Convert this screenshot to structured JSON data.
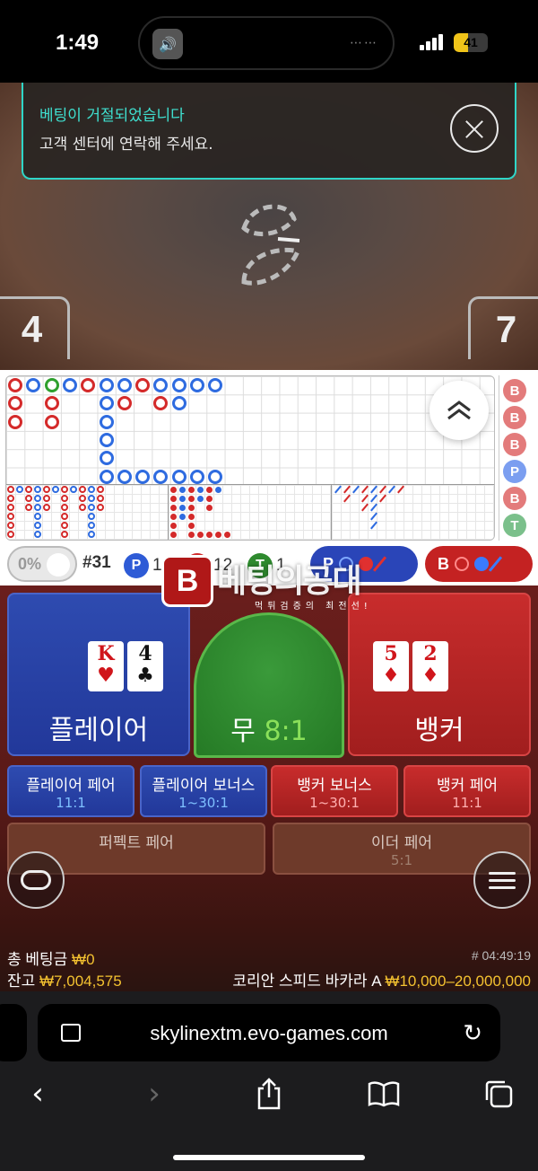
{
  "status_bar": {
    "time": "1:49",
    "battery": "41",
    "battery_level_percent": 41
  },
  "notification": {
    "title": "베팅이 거절되었습니다",
    "message": "고객 센터에 연락해 주세요."
  },
  "video": {
    "player_score": "4",
    "banker_score": "7"
  },
  "colors": {
    "player": "#2e4bb0",
    "banker": "#c82c2c",
    "tie": "#2e8a2e",
    "accent": "#2fd6c8",
    "gold": "#f4c230"
  },
  "side_column": [
    "B",
    "B",
    "B",
    "P",
    "B",
    "T"
  ],
  "stats": {
    "percent": "0%",
    "round": "#31",
    "player": {
      "badge": "P",
      "count": "18"
    },
    "banker": {
      "badge": "B",
      "count": "12"
    },
    "tie": {
      "badge": "T",
      "count": "1"
    },
    "player_ask": "P",
    "banker_ask": "B"
  },
  "watermark": {
    "icon": "B",
    "title": "베팅의공대",
    "subtitle": "먹튀검증의 최전선!"
  },
  "bets": {
    "player": {
      "label": "플레이어",
      "cards": [
        {
          "rank": "K",
          "suit": "♥"
        },
        {
          "rank": "4",
          "suit": "♣"
        }
      ]
    },
    "tie": {
      "label": "무",
      "odds": "8:1"
    },
    "banker": {
      "label": "뱅커",
      "cards": [
        {
          "rank": "5",
          "suit": "♦"
        },
        {
          "rank": "2",
          "suit": "♦"
        }
      ]
    },
    "side": [
      {
        "name": "플레이어 페어",
        "odds": "11:1"
      },
      {
        "name": "플레이어 보너스",
        "odds": "1~30:1"
      },
      {
        "name": "뱅커 보너스",
        "odds": "1~30:1"
      },
      {
        "name": "뱅커 페어",
        "odds": "11:1"
      }
    ],
    "perfect_pair": {
      "name": "퍼펙트 페어"
    },
    "either_pair": {
      "name": "이더 페어",
      "odds": "5:1"
    }
  },
  "info": {
    "total_bet_label": "총 베팅금",
    "total_bet": "₩0",
    "balance_label": "잔고",
    "balance": "₩7,004,575",
    "game_id": "# 04:49:19",
    "table_name": "코리안 스피드 바카라 A",
    "limits": "₩10,000–20,000,000"
  },
  "browser": {
    "url": "skylinextm.evo-games.com"
  }
}
